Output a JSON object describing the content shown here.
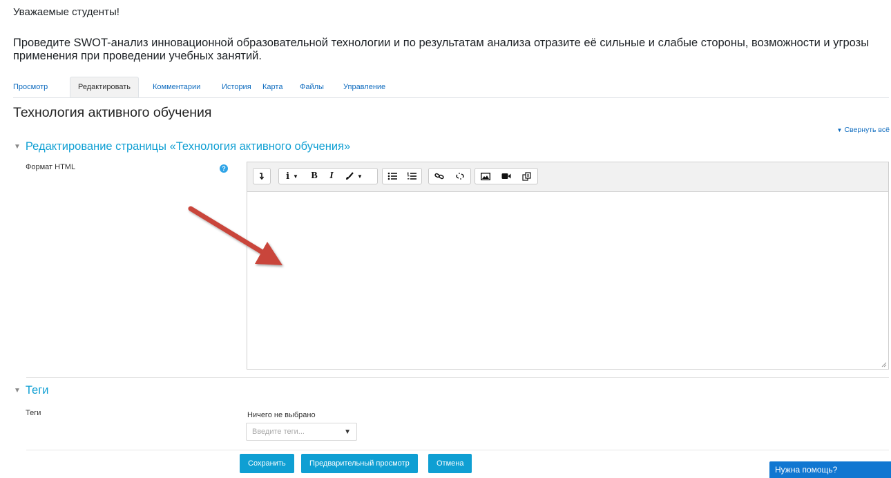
{
  "intro": {
    "greeting": "Уважаемые студенты!",
    "task": "Проведите SWOT-анализ инновационной образовательной технологии и по результатам анализа отразите её сильные и слабые стороны, возможности и угрозы применения при проведении учебных занятий."
  },
  "tabs": [
    {
      "label": "Просмотр",
      "active": false
    },
    {
      "label": "Редактировать",
      "active": true
    },
    {
      "label": "Комментарии",
      "active": false
    },
    {
      "label": "История",
      "active": false
    },
    {
      "label": "Карта",
      "active": false
    },
    {
      "label": "Файлы",
      "active": false
    },
    {
      "label": "Управление",
      "active": false
    }
  ],
  "page_title": "Технология активного обучения",
  "collapse_all": "Свернуть всё",
  "edit_section": {
    "title": "Редактирование страницы «Технология активного обучения»",
    "format_label": "Формат HTML",
    "help_icon": "question-circle-icon",
    "toolbar": [
      "collapse-icon",
      "info-style-icon",
      "bold-icon",
      "italic-icon",
      "text-color-icon",
      "bullet-list-icon",
      "numbered-list-icon",
      "link-icon",
      "unlink-icon",
      "image-icon",
      "video-icon",
      "manage-files-icon"
    ],
    "bold_glyph": "B",
    "italic_glyph": "I",
    "content": ""
  },
  "tags_section": {
    "title": "Теги",
    "field_label": "Теги",
    "selected_text": "Ничего не выбрано",
    "placeholder": "Введите теги...",
    "dropdown_glyph": "▼"
  },
  "buttons": {
    "save": "Сохранить",
    "preview": "Предварительный просмотр",
    "cancel": "Отмена"
  },
  "help_widget": "Нужна помощь?",
  "colors": {
    "link": "#0f6cbf",
    "section_heading": "#0f9fd3",
    "button": "#0f9fd3",
    "annotation_arrow": "#c9453a",
    "help_widget": "#1177d1"
  }
}
